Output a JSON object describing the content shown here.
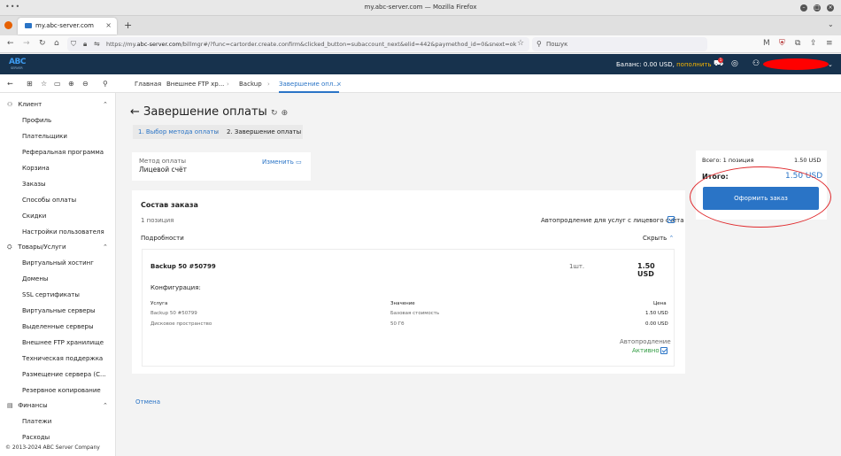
{
  "browser": {
    "window_title": "my.abc-server.com — Mozilla Firefox",
    "tab_title": "my.abc-server.com",
    "url_prefix": "https://my.",
    "url_domain": "abc-server.com",
    "url_rest": "/billmgr#/?func=cartorder.create.confirm&clicked_button=subaccount_next&elid=442&paymethod_id=0&snext=ok",
    "search_placeholder": "Пошук"
  },
  "header": {
    "logo_text": "ABC",
    "logo_sub": "SERVER",
    "balance_label": "Баланс: 0.00 USD,",
    "topup_label": "пополнить"
  },
  "apptabs": {
    "crumbs": [
      "Главная",
      "Внешнее FTP хр...",
      "Backup",
      "Завершение опл..."
    ]
  },
  "sidebar": {
    "groups": [
      {
        "label": "Клиент",
        "items": [
          "Профиль",
          "Плательщики",
          "Реферальная программа",
          "Корзина",
          "Заказы",
          "Способы оплаты",
          "Скидки",
          "Настройки пользователя"
        ]
      },
      {
        "label": "Товары/Услуги",
        "items": [
          "Виртуальный хостинг",
          "Домены",
          "SSL сертификаты",
          "Виртуальные серверы",
          "Выделенные серверы",
          "Внешнее FTP хранилище",
          "Техническая поддержка",
          "Размещение сервера (С...",
          "Резервное копирование"
        ]
      },
      {
        "label": "Финансы",
        "items": [
          "Платежи",
          "Расходы"
        ]
      }
    ],
    "copyright": "© 2013-2024 ABC Server Company"
  },
  "main": {
    "title": "Завершение оплаты",
    "steps": [
      "1. Выбор метода оплаты",
      "2. Завершение оплаты"
    ],
    "payment": {
      "label": "Метод оплаты",
      "value": "Лицевой счёт",
      "change": "Изменить"
    },
    "order": {
      "title": "Состав заказа",
      "count": "1 позиция",
      "autorenew_label": "Автопродление для услуг с лицевого счёта",
      "details_label": "Подробности",
      "hide_label": "Скрыть",
      "item_name": "Backup 50 #50799",
      "item_qty": "1шт.",
      "item_price": "1.50 USD",
      "config_label": "Конфигурация:",
      "columns": [
        "Услуга",
        "Значение",
        "Цена"
      ],
      "rows": [
        [
          "Backup 50 #50799",
          "Базовая стоимость",
          "1.50 USD"
        ],
        [
          "Дисковое пространство",
          "50 Гб",
          "0.00 USD"
        ]
      ],
      "autorenew_item_label": "Автопродление",
      "autorenew_item_status": "Активно"
    },
    "cancel": "Отмена"
  },
  "summary": {
    "total_positions": "Всего: 1 позиция",
    "total_positions_price": "1.50 USD",
    "total_label": "Итого:",
    "total_value": "1.50 USD",
    "order_button": "Оформить заказ"
  }
}
